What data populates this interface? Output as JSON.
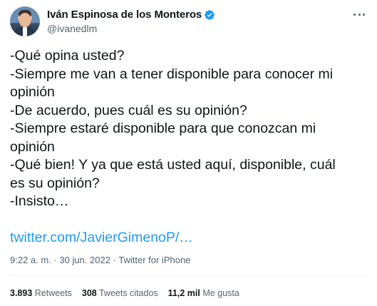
{
  "author": {
    "display_name": "Iván Espinosa de los Monteros",
    "handle": "@ivanedlm",
    "verified_color": "#1d9bf0"
  },
  "tweet": {
    "lines": [
      "-Qué opina usted?",
      "-Siempre me van a tener disponible para conocer mi",
      "opinión",
      "-De acuerdo, pues cuál es su opinión?",
      "-Siempre estaré disponible para que conozcan mi",
      "opinión",
      "-Qué bien! Y ya que está usted aquí, disponible, cuál",
      "es su opinión?",
      "-Insisto…"
    ],
    "link": "twitter.com/JavierGimenoP/…",
    "link_color": "#1d9bf0"
  },
  "meta": {
    "time": "9:22 a. m.",
    "separator": " · ",
    "date": "30 jun. 2022",
    "source": "Twitter for iPhone"
  },
  "stats": {
    "retweets_count": "3.893",
    "retweets_label": "Retweets",
    "quotes_count": "308",
    "quotes_label": "Tweets citados",
    "likes_count": "11,2 mil",
    "likes_label": "Me gusta"
  },
  "icons": {
    "avatar": "avatar-photo",
    "verified": "verified-badge-icon",
    "more": "more-options-icon"
  }
}
